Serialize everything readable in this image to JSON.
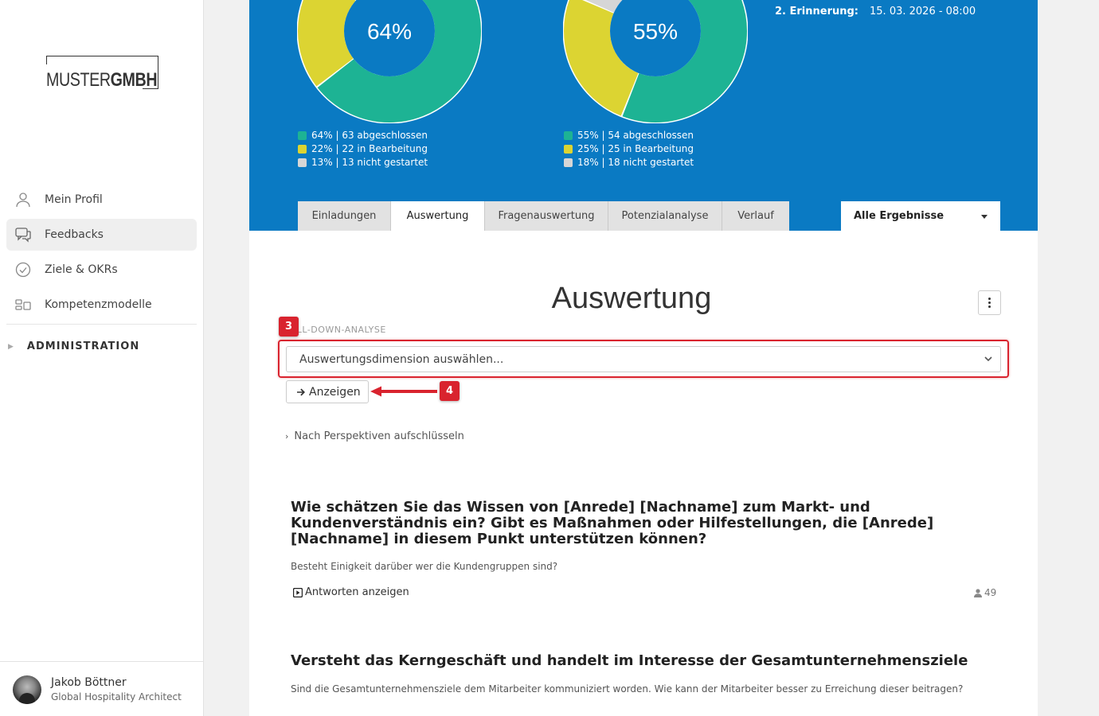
{
  "brand": {
    "logo_thin": "MUSTER",
    "logo_bold": "GMBH"
  },
  "sidebar": {
    "items": [
      {
        "label": "Mein Profil",
        "icon": "user-icon"
      },
      {
        "label": "Feedbacks",
        "icon": "chat-icon",
        "active": true
      },
      {
        "label": "Ziele & OKRs",
        "icon": "check-circle-icon"
      },
      {
        "label": "Kompetenzmodelle",
        "icon": "grid-icon"
      }
    ],
    "admin_label": "ADMINISTRATION"
  },
  "user": {
    "name": "Jakob Böttner",
    "role": "Global Hospitality Architect"
  },
  "hero": {
    "donut1": {
      "center_label": "64%",
      "values": [
        64,
        22,
        13
      ],
      "legend": [
        "64% | 63 abgeschlossen",
        "22% | 22 in Bearbeitung",
        "13% | 13 nicht gestartet"
      ]
    },
    "donut2": {
      "center_label": "55%",
      "values": [
        55,
        25,
        18
      ],
      "legend": [
        "55% | 54 abgeschlossen",
        "25% | 25 in Bearbeitung",
        "18% | 18 nicht gestartet"
      ]
    },
    "colors": {
      "done": "#1db394",
      "progress": "#dcd432",
      "open": "#d6d6d6",
      "hero_bg": "#0a7ac3"
    },
    "reminder_label": "2. Erinnerung:",
    "reminder_value": "15. 03. 2026 - 08:00"
  },
  "tabs": [
    "Einladungen",
    "Auswertung",
    "Fragenauswertung",
    "Potenzialanalyse",
    "Verlauf"
  ],
  "active_tab": "Auswertung",
  "filter": {
    "label": "Alle Ergebnisse"
  },
  "content": {
    "title": "Auswertung",
    "section_label": "ILL-DOWN-ANALYSE",
    "select_placeholder": "Auswertungsdimension auswählen...",
    "show_button": "Anzeigen",
    "expand_link": "Nach Perspektiven aufschlüsseln",
    "badge3": "3",
    "badge4": "4"
  },
  "questions": [
    {
      "title": "Wie schätzen Sie das Wissen von [Anrede] [Nachname] zum Markt- und Kundenverständnis ein? Gibt es Maßnahmen oder Hilfestellungen, die [Anrede] [Nachname] in diesem Punkt unterstützen können?",
      "subtitle": "Besteht Einigkeit darüber wer die Kundengruppen sind?",
      "answers_link": "Antworten anzeigen",
      "count": "49"
    },
    {
      "title": "Versteht das Kerngeschäft und handelt im Interesse der Gesamtunternehmensziele",
      "subtitle": "Sind die Gesamtunternehmensziele dem Mitarbeiter kommuniziert worden. Wie kann der Mitarbeiter besser zu Erreichung dieser beitragen?"
    }
  ]
}
